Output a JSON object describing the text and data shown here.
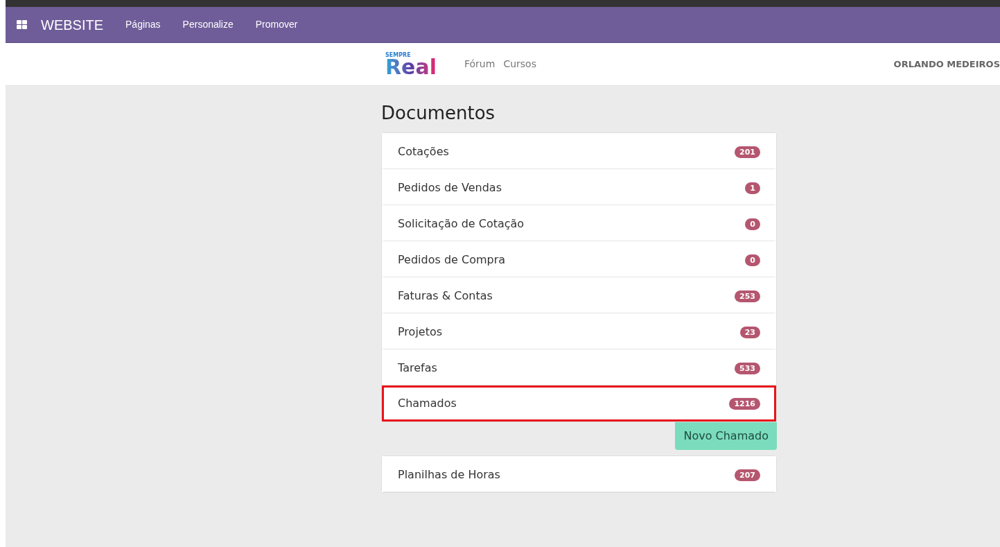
{
  "topbar": {
    "app": "WEBSITE",
    "menu": [
      "Páginas",
      "Personalize",
      "Promover"
    ]
  },
  "header": {
    "logo": {
      "small": "SEMPRE",
      "big": "Real"
    },
    "nav": [
      "Fórum",
      "Cursos"
    ],
    "user": "ORLANDO MEDEIROS"
  },
  "title": "Documentos",
  "documents": [
    {
      "label": "Cotações",
      "count": "201",
      "highlighted": false
    },
    {
      "label": "Pedidos de Vendas",
      "count": "1",
      "highlighted": false
    },
    {
      "label": "Solicitação de Cotação",
      "count": "0",
      "highlighted": false
    },
    {
      "label": "Pedidos de Compra",
      "count": "0",
      "highlighted": false
    },
    {
      "label": "Faturas & Contas",
      "count": "253",
      "highlighted": false
    },
    {
      "label": "Projetos",
      "count": "23",
      "highlighted": false
    },
    {
      "label": "Tarefas",
      "count": "533",
      "highlighted": false
    },
    {
      "label": "Chamados",
      "count": "1216",
      "highlighted": true
    }
  ],
  "new_button": "Novo Chamado",
  "extra_documents": [
    {
      "label": "Planilhas de Horas",
      "count": "207",
      "highlighted": false
    }
  ]
}
